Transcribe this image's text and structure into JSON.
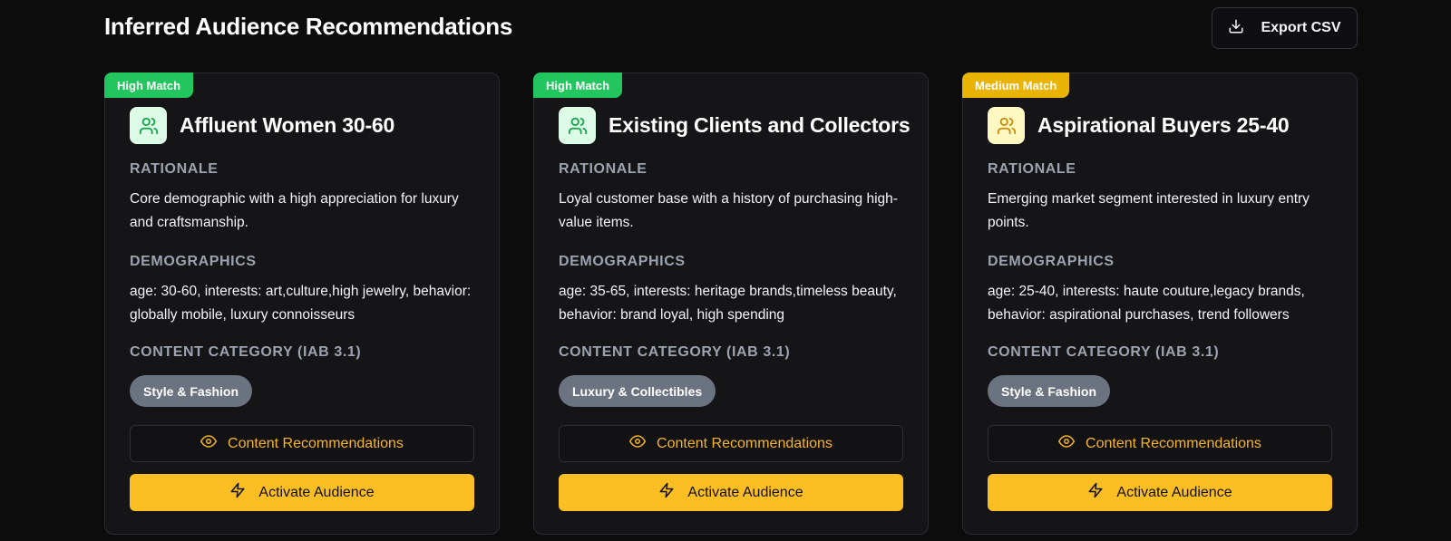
{
  "header": {
    "title": "Inferred Audience Recommendations",
    "export_label": "Export CSV",
    "export_icon": "download-icon"
  },
  "cards": [
    {
      "badge": "High Match",
      "badge_color": "#22c55e",
      "icon": "users-icon",
      "title": "Affluent Women 30-60",
      "rationale_label": "RATIONALE",
      "rationale": "Core demographic with a high appreciation for luxury and craftsmanship.",
      "demographics_label": "DEMOGRAPHICS",
      "demographics": "age: 30-60, interests: art,culture,high jewelry, behavior: globally mobile, luxury connoisseurs",
      "content_category_label": "CONTENT CATEGORY (IAB 3.1)",
      "category": "Style & Fashion",
      "content_button": "Content Recommendations",
      "activate_button": "Activate Audience"
    },
    {
      "badge": "High Match",
      "badge_color": "#22c55e",
      "icon": "users-icon",
      "title": "Existing Clients and Collectors",
      "rationale_label": "RATIONALE",
      "rationale": "Loyal customer base with a history of purchasing high-value items.",
      "demographics_label": "DEMOGRAPHICS",
      "demographics": "age: 35-65, interests: heritage brands,timeless beauty, behavior: brand loyal, high spending",
      "content_category_label": "CONTENT CATEGORY (IAB 3.1)",
      "category": "Luxury & Collectibles",
      "content_button": "Content Recommendations",
      "activate_button": "Activate Audience"
    },
    {
      "badge": "Medium Match",
      "badge_color": "#eab308",
      "icon": "users-icon",
      "title": "Aspirational Buyers 25-40",
      "rationale_label": "RATIONALE",
      "rationale": "Emerging market segment interested in luxury entry points.",
      "demographics_label": "DEMOGRAPHICS",
      "demographics": "age: 25-40, interests: haute couture,legacy brands, behavior: aspirational purchases, trend followers",
      "content_category_label": "CONTENT CATEGORY (IAB 3.1)",
      "category": "Style & Fashion",
      "content_button": "Content Recommendations",
      "activate_button": "Activate Audience"
    }
  ],
  "colors": {
    "accent": "#fbbf24",
    "high_match": "#22c55e",
    "medium_match": "#eab308",
    "background": "#0c0c0d",
    "card": "#151518"
  }
}
